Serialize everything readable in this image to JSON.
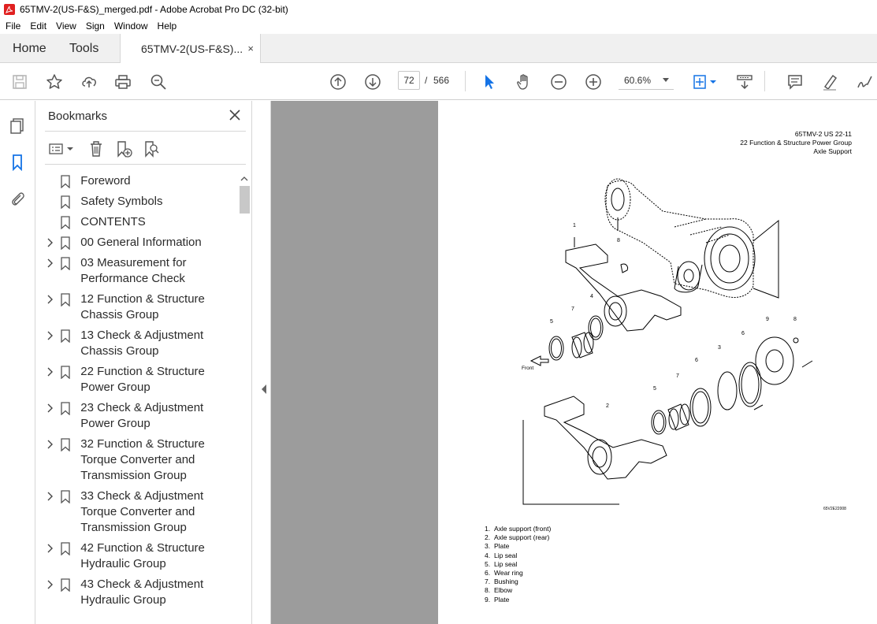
{
  "window": {
    "title": "65TMV-2(US-F&S)_merged.pdf - Adobe Acrobat Pro DC (32-bit)"
  },
  "menu": [
    "File",
    "Edit",
    "View",
    "Sign",
    "Window",
    "Help"
  ],
  "tabs": {
    "home": "Home",
    "tools": "Tools",
    "document": "65TMV-2(US-F&S)...",
    "close_glyph": "×"
  },
  "toolbar": {
    "current_page": "72",
    "page_separator": "/",
    "total_pages": "566",
    "zoom": "60.6%",
    "icons": [
      "save-icon",
      "star-icon",
      "upload-icon",
      "print-icon",
      "zoom-search-icon",
      "page-up-icon",
      "page-down-icon",
      "select-arrow-icon",
      "hand-icon",
      "zoom-out-icon",
      "zoom-in-icon",
      "fit-page-icon",
      "scroll-mode-icon",
      "comment-icon",
      "highlight-icon",
      "sign-icon"
    ]
  },
  "bookmarks": {
    "title": "Bookmarks",
    "close_glyph": "✕",
    "items": [
      {
        "label": "Foreword",
        "expandable": false
      },
      {
        "label": "Safety Symbols",
        "expandable": false
      },
      {
        "label": "CONTENTS",
        "expandable": false
      },
      {
        "label": "00 General Information",
        "expandable": true
      },
      {
        "label": "03 Measurement for Performance Check",
        "expandable": true
      },
      {
        "label": "12 Function & Structure Chassis Group",
        "expandable": true
      },
      {
        "label": "13 Check & Adjustment Chassis Group",
        "expandable": true
      },
      {
        "label": "22 Function & Structure Power Group",
        "expandable": true
      },
      {
        "label": "23 Check & Adjustment Power Group",
        "expandable": true
      },
      {
        "label": "32 Function & Structure Torque Converter and Transmission Group",
        "expandable": true
      },
      {
        "label": "33 Check & Adjustment Torque Converter and Transmission Group",
        "expandable": true
      },
      {
        "label": "42 Function & Structure Hydraulic Group",
        "expandable": true
      },
      {
        "label": "43 Check & Adjustment Hydraulic Group",
        "expandable": true
      }
    ]
  },
  "page": {
    "header_lines": [
      "65TMV-2 US 22-11",
      "22 Function & Structure Power Group",
      "Axle Support"
    ],
    "figure_code": "65V2E22008",
    "front_label": "Front",
    "callouts": {
      "c1": "1",
      "c2": "2",
      "c3": "3",
      "c4": "4",
      "c5a": "5",
      "c5b": "5",
      "c6a": "6",
      "c6b": "6",
      "c7a": "7",
      "c7b": "7",
      "c8a": "8",
      "c8b": "8",
      "c9": "9"
    },
    "parts": [
      {
        "num": "1.",
        "name": "Axle support (front)"
      },
      {
        "num": "2.",
        "name": "Axle support (rear)"
      },
      {
        "num": "3.",
        "name": "Plate"
      },
      {
        "num": "4.",
        "name": "Lip seal"
      },
      {
        "num": "5.",
        "name": "Lip seal"
      },
      {
        "num": "6.",
        "name": "Wear ring"
      },
      {
        "num": "7.",
        "name": "Bushing"
      },
      {
        "num": "8.",
        "name": "Elbow"
      },
      {
        "num": "9.",
        "name": "Plate"
      }
    ]
  }
}
